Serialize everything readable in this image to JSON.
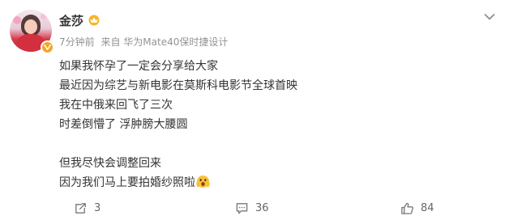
{
  "post": {
    "user": {
      "name": "金莎"
    },
    "meta": {
      "time": "7分钟前",
      "source": "来自 华为Mate40保时捷设计"
    },
    "lines": [
      "如果我怀孕了一定会分享给大家",
      "最近因为综艺与新电影在莫斯科电影节全球首映",
      "我在中俄来回飞了三次",
      "时差倒懵了 浮肿膀大腰圆",
      "",
      "但我尽快会调整回来",
      "因为我们马上要拍婚纱照啦"
    ],
    "actions": {
      "repost_count": "3",
      "comment_count": "36",
      "like_count": "84"
    }
  },
  "colors": {
    "text": "#333333",
    "meta": "#939393",
    "badge": "#f5a623"
  },
  "icons": [
    "vip-badge-icon",
    "crown-icon",
    "more-chevron-icon",
    "shocked-emoji-icon",
    "repost-icon",
    "comment-icon",
    "like-icon"
  ]
}
